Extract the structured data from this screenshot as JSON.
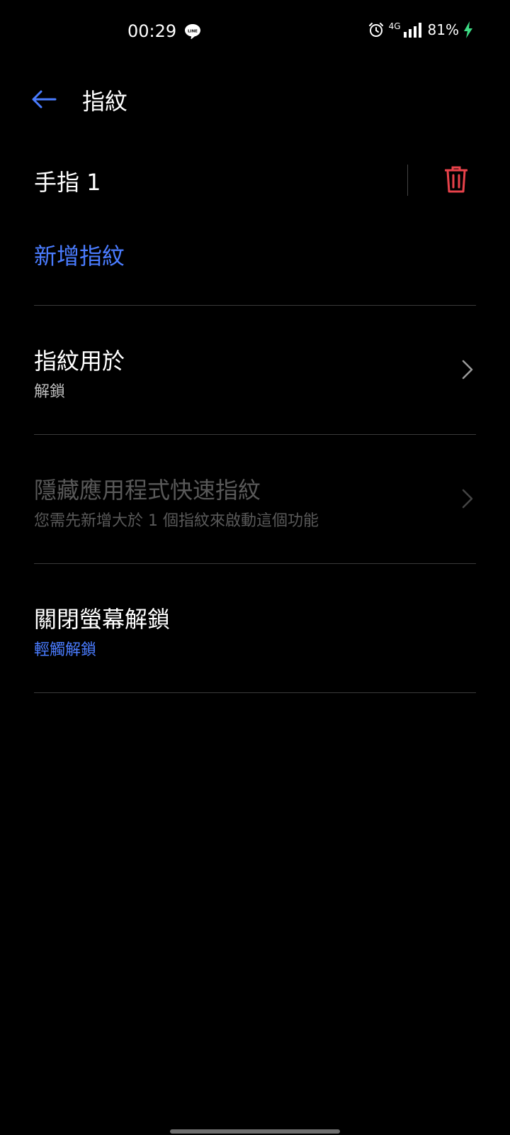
{
  "status_bar": {
    "time": "00:29",
    "network": "4G",
    "battery": "81%"
  },
  "header": {
    "title": "指紋"
  },
  "fingerprints": [
    {
      "name": "手指 1"
    }
  ],
  "add_fingerprint_label": "新增指紋",
  "menu": {
    "fingerprint_use": {
      "title": "指紋用於",
      "subtitle": "解鎖"
    },
    "hide_apps": {
      "title": "隱藏應用程式快速指紋",
      "subtitle": "您需先新增大於 1 個指紋來啟動這個功能"
    },
    "screen_off_unlock": {
      "title": "關閉螢幕解鎖",
      "subtitle": "輕觸解鎖"
    }
  },
  "colors": {
    "accent": "#4a7cff",
    "delete": "#e8424a",
    "background": "#000000"
  }
}
